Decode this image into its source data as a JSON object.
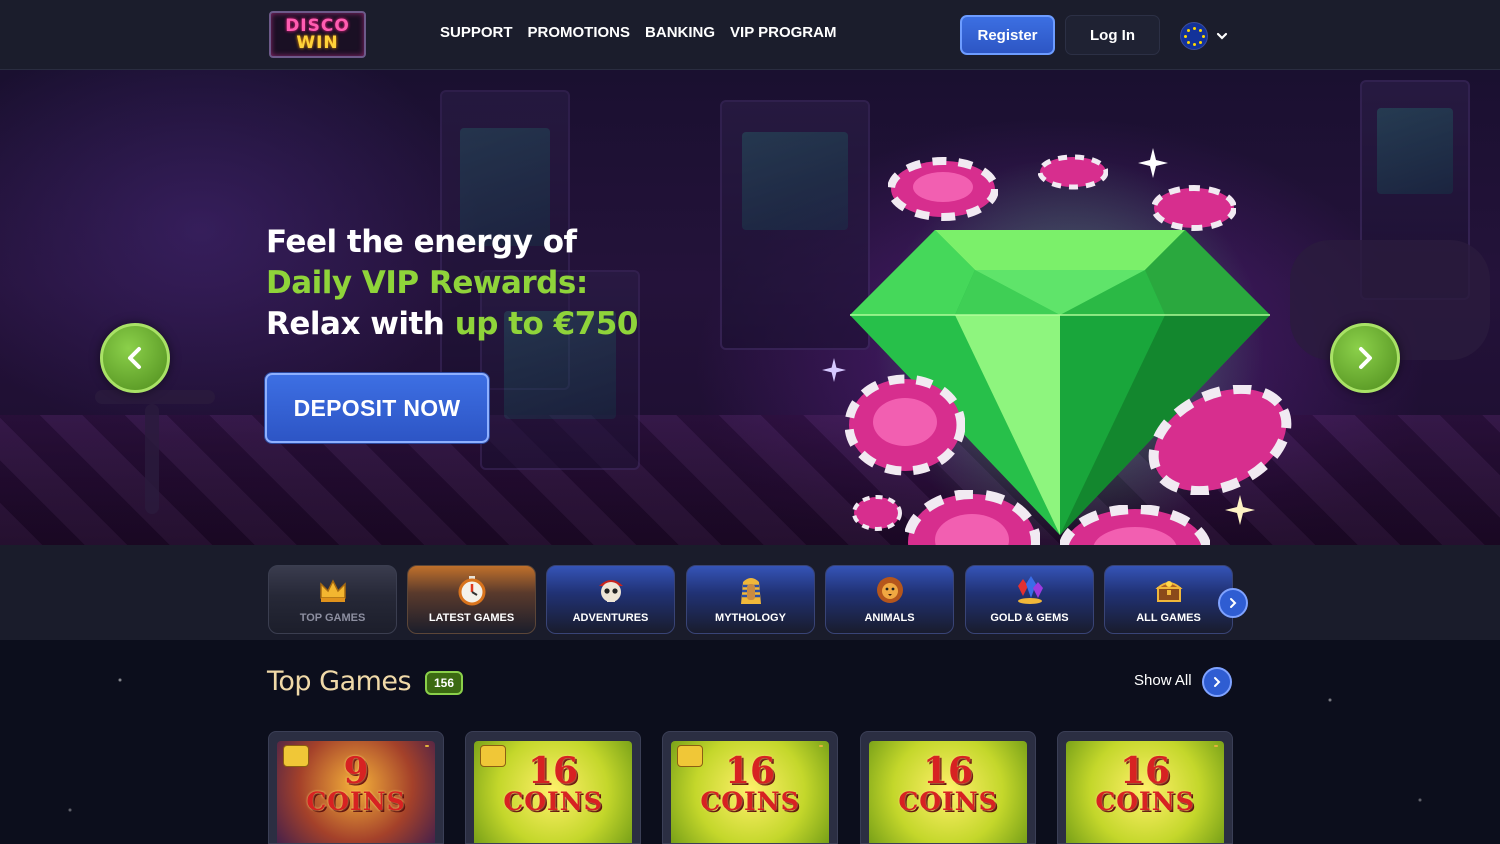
{
  "header": {
    "logo_line1": "DISCO",
    "logo_line2": "WIN",
    "nav": [
      "SUPPORT",
      "PROMOTIONS",
      "BANKING",
      "VIP PROGRAM"
    ],
    "register_label": "Register",
    "login_label": "Log In",
    "language_icon": "eu-flag-icon"
  },
  "hero": {
    "line1": "Feel the energy of",
    "line2": "Daily VIP Rewards:",
    "line3_prefix": "Relax with ",
    "line3_highlight": "up to €750",
    "deposit_label": "DEPOSIT NOW",
    "slides_total": 4,
    "active_slide": 3,
    "accent_green": "#8fd43a",
    "button_blue": "#3d6fe3"
  },
  "categories": [
    {
      "label": "TOP GAMES",
      "icon": "crown-icon"
    },
    {
      "label": "LATEST GAMES",
      "icon": "stopwatch-icon"
    },
    {
      "label": "ADVENTURES",
      "icon": "pirate-skull-icon"
    },
    {
      "label": "MYTHOLOGY",
      "icon": "pharaoh-icon"
    },
    {
      "label": "ANIMALS",
      "icon": "lion-icon"
    },
    {
      "label": "GOLD & GEMS",
      "icon": "gems-icon"
    },
    {
      "label": "ALL GAMES",
      "icon": "treasure-chest-icon"
    }
  ],
  "top_games": {
    "title": "Top Games",
    "count": "156",
    "show_all_label": "Show All",
    "games": [
      {
        "number": "9",
        "word": "COINS"
      },
      {
        "number": "16",
        "word": "COINS"
      },
      {
        "number": "16",
        "word": "COINS"
      },
      {
        "number": "16",
        "word": "COINS"
      },
      {
        "number": "16",
        "word": "COINS"
      }
    ]
  }
}
